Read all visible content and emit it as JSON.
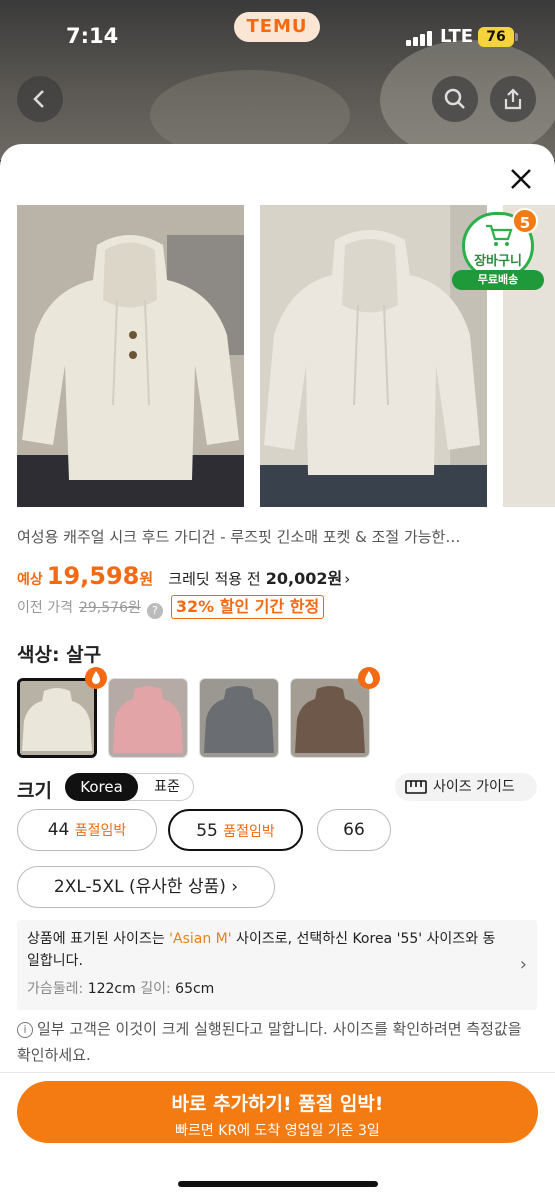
{
  "status_bar": {
    "time": "7:14",
    "app_badge": "TEMU",
    "network": "LTE",
    "battery": "76"
  },
  "product": {
    "title": "여성용 캐주얼 시크 후드 가디건 - 루즈핏 긴소매 포켓 & 조절 가능한…",
    "price_label": "예상",
    "price_value": "19,598",
    "price_unit": "원",
    "credit_text": "크레딧 적용 전",
    "credit_price": "20,002원",
    "credit_chevron": "›",
    "prev_label": "이전 가격",
    "prev_price": "29,576원",
    "discount": "32% 할인 기간 한정"
  },
  "cart": {
    "count": "5",
    "label": "장바구니",
    "free_shipping": "무료배송"
  },
  "color": {
    "label": "색상: 살구"
  },
  "size": {
    "label": "크기",
    "toggle_on": "Korea",
    "toggle_off": "표준",
    "guide": "사이즈 가이드",
    "options": [
      {
        "value": "44",
        "tag": "품절임박"
      },
      {
        "value": "55",
        "tag": "품절임박"
      },
      {
        "value": "66",
        "tag": ""
      }
    ],
    "similar": "2XL-5XL (유사한 상품) ›"
  },
  "info": {
    "msg_a": "상품에 표기된 사이즈는 ",
    "msg_hl": "'Asian M'",
    "msg_b": " 사이즈로, 선택하신 Korea '55' 사이즈와 동일합니다.",
    "chest_key": "가슴둘레:",
    "chest_val": "122cm",
    "length_key": "길이:",
    "length_val": "65cm"
  },
  "note": "일부 고객은 이것이 크게 실행된다고 말합니다. 사이즈를 확인하려면 측정값을 확인하세요.",
  "cta": {
    "main": "바로 추가하기! 품절 임박!",
    "sub": "빠르면 KR에 도착 영업일 기준 3일"
  },
  "colors": {
    "accent": "#f46a12",
    "green": "#2bb04a"
  }
}
